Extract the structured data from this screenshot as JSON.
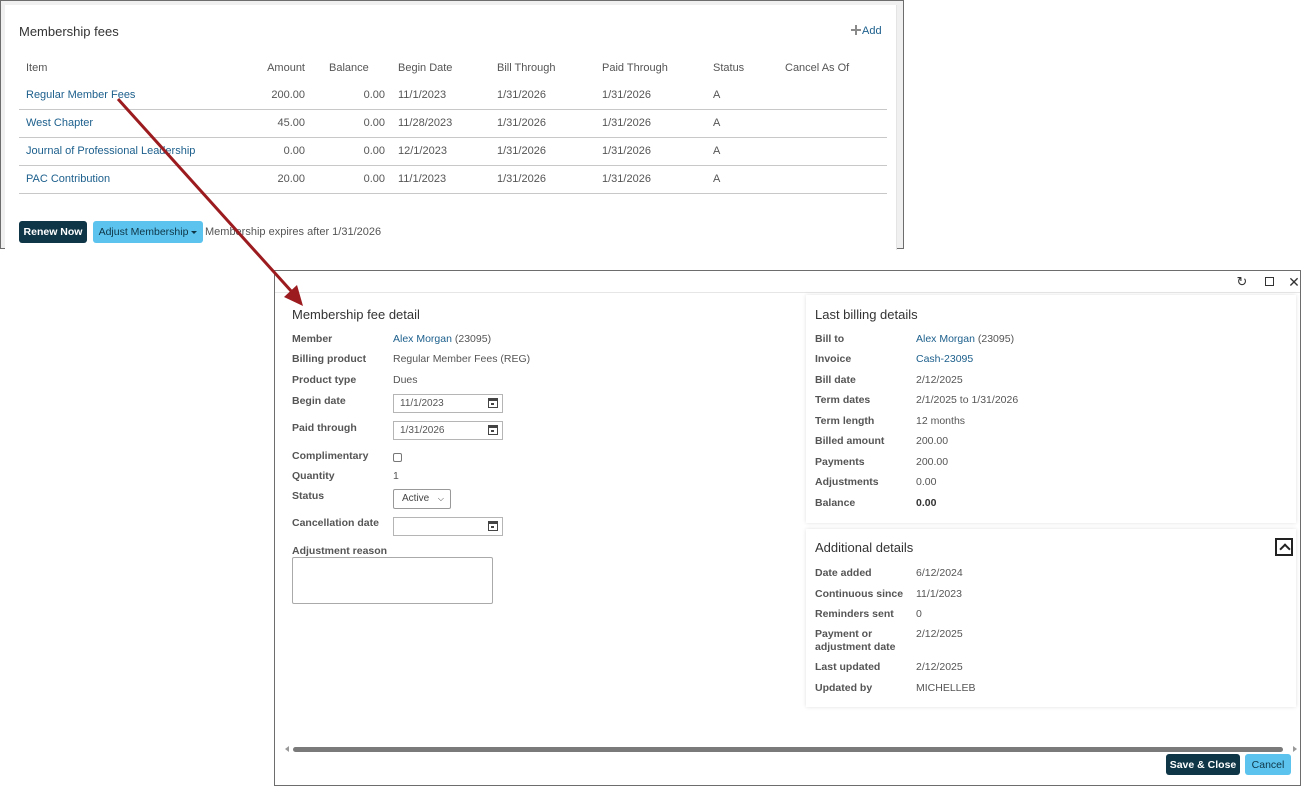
{
  "fees": {
    "title": "Membership fees",
    "add_label": "Add",
    "columns": [
      "Item",
      "Amount",
      "Balance",
      "Begin Date",
      "Bill Through",
      "Paid Through",
      "Status",
      "Cancel As Of"
    ],
    "rows": [
      {
        "item": "Regular Member Fees",
        "amount": "200.00",
        "balance": "0.00",
        "begin": "11/1/2023",
        "bill_through": "1/31/2026",
        "paid_through": "1/31/2026",
        "status": "A",
        "cancel": ""
      },
      {
        "item": "West Chapter",
        "amount": "45.00",
        "balance": "0.00",
        "begin": "11/28/2023",
        "bill_through": "1/31/2026",
        "paid_through": "1/31/2026",
        "status": "A",
        "cancel": ""
      },
      {
        "item": "Journal of Professional Leadership",
        "amount": "0.00",
        "balance": "0.00",
        "begin": "12/1/2023",
        "bill_through": "1/31/2026",
        "paid_through": "1/31/2026",
        "status": "A",
        "cancel": ""
      },
      {
        "item": "PAC Contribution",
        "amount": "20.00",
        "balance": "0.00",
        "begin": "11/1/2023",
        "bill_through": "1/31/2026",
        "paid_through": "1/31/2026",
        "status": "A",
        "cancel": ""
      }
    ],
    "renew_label": "Renew Now",
    "adjust_label": "Adjust Membership",
    "expires_text": "Membership expires after 1/31/2026"
  },
  "detail": {
    "title": "Membership fee detail",
    "labels": {
      "member": "Member",
      "billing_product": "Billing product",
      "product_type": "Product type",
      "begin_date": "Begin date",
      "paid_through": "Paid through",
      "complimentary": "Complimentary",
      "quantity": "Quantity",
      "status": "Status",
      "cancellation_date": "Cancellation date",
      "adjustment_reason": "Adjustment reason"
    },
    "member_name": "Alex Morgan",
    "member_id": "(23095)",
    "billing_product": "Regular Member Fees (REG)",
    "product_type": "Dues",
    "begin_date": "11/1/2023",
    "paid_through": "1/31/2026",
    "quantity": "1",
    "status": "Active",
    "cancellation_date": ""
  },
  "billing": {
    "title": "Last billing details",
    "labels": {
      "bill_to": "Bill to",
      "invoice": "Invoice",
      "bill_date": "Bill date",
      "term_dates": "Term dates",
      "term_length": "Term length",
      "billed_amount": "Billed amount",
      "payments": "Payments",
      "adjustments": "Adjustments",
      "balance": "Balance"
    },
    "bill_to_name": "Alex Morgan",
    "bill_to_id": "(23095)",
    "invoice": "Cash-23095",
    "bill_date": "2/12/2025",
    "term_dates": "2/1/2025 to 1/31/2026",
    "term_length": "12 months",
    "billed_amount": "200.00",
    "payments": "200.00",
    "adjustments": "0.00",
    "balance": "0.00"
  },
  "additional": {
    "title": "Additional details",
    "labels": {
      "date_added": "Date added",
      "continuous_since": "Continuous since",
      "reminders_sent": "Reminders sent",
      "payment_date_line1": "Payment or",
      "payment_date_line2": "adjustment date",
      "last_updated": "Last updated",
      "updated_by": "Updated by"
    },
    "date_added": "6/12/2024",
    "continuous_since": "11/1/2023",
    "reminders_sent": "0",
    "payment_date": "2/12/2025",
    "last_updated": "2/12/2025",
    "updated_by": "MICHELLEB"
  },
  "buttons": {
    "save_close": "Save & Close",
    "cancel": "Cancel"
  },
  "window_icons": {
    "refresh": "↻",
    "close": "✕"
  },
  "colors": {
    "link": "#1c5f8c",
    "primary_button": "#0f3647",
    "secondary_button": "#5bc3ee",
    "arrow": "#9b1b1f"
  }
}
